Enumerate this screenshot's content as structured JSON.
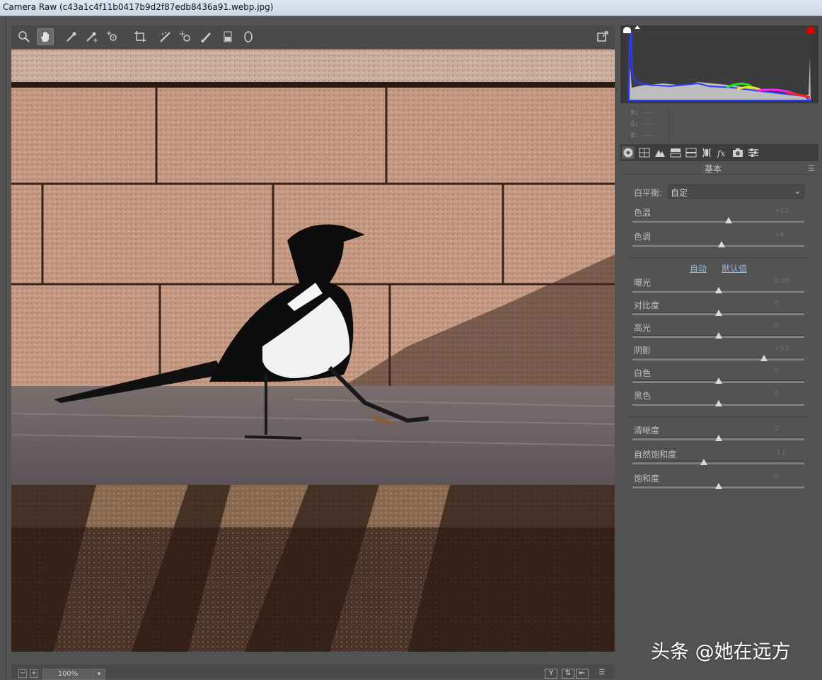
{
  "window": {
    "title": "Camera Raw (c43a1c4f11b0417b9d2f87edb8436a91.webp.jpg)"
  },
  "toolbar": {
    "tools": [
      "zoom-icon",
      "hand-icon",
      "white-balance-icon",
      "color-sampler-icon",
      "targeted-adjustment-icon",
      "crop-icon",
      "straighten-icon",
      "spot-removal-icon",
      "red-eye-icon",
      "adjustment-brush-icon",
      "graduated-filter-icon",
      "radial-filter-icon"
    ],
    "export_icon": "open-preferences-icon"
  },
  "status": {
    "zoom_value": "100%",
    "minus": "−",
    "plus": "+"
  },
  "rgb_readout": {
    "r": "R:  ---",
    "g": "G:  ---",
    "b": "B:  ---"
  },
  "panel": {
    "title": "基本",
    "white_balance": {
      "label": "白平衡:",
      "value": "自定"
    },
    "links": {
      "auto": "自动",
      "default": "默认值"
    },
    "sliders": [
      {
        "label": "色温",
        "value": "+12",
        "level": 0.56
      },
      {
        "label": "色调",
        "value": "+4",
        "level": 0.52
      },
      {
        "label": "曝光",
        "value": "0.00",
        "level": 0.5
      },
      {
        "label": "对比度",
        "value": "0",
        "level": 0.5
      },
      {
        "label": "高光",
        "value": "0",
        "level": 0.5
      },
      {
        "label": "阴影",
        "value": "+53",
        "level": 0.765
      },
      {
        "label": "白色",
        "value": "0",
        "level": 0.5
      },
      {
        "label": "黑色",
        "value": "0",
        "level": 0.5
      },
      {
        "label": "清晰度",
        "value": "0",
        "level": 0.5
      },
      {
        "label": "自然饱和度",
        "value": "-17",
        "level": 0.415
      },
      {
        "label": "饱和度",
        "value": "0",
        "level": 0.5
      }
    ]
  },
  "watermark": "头条 @她在远方",
  "colors": {
    "panel_bg": "#535353",
    "link": "#8fb4d8",
    "clip_highlight": "#e00000"
  }
}
